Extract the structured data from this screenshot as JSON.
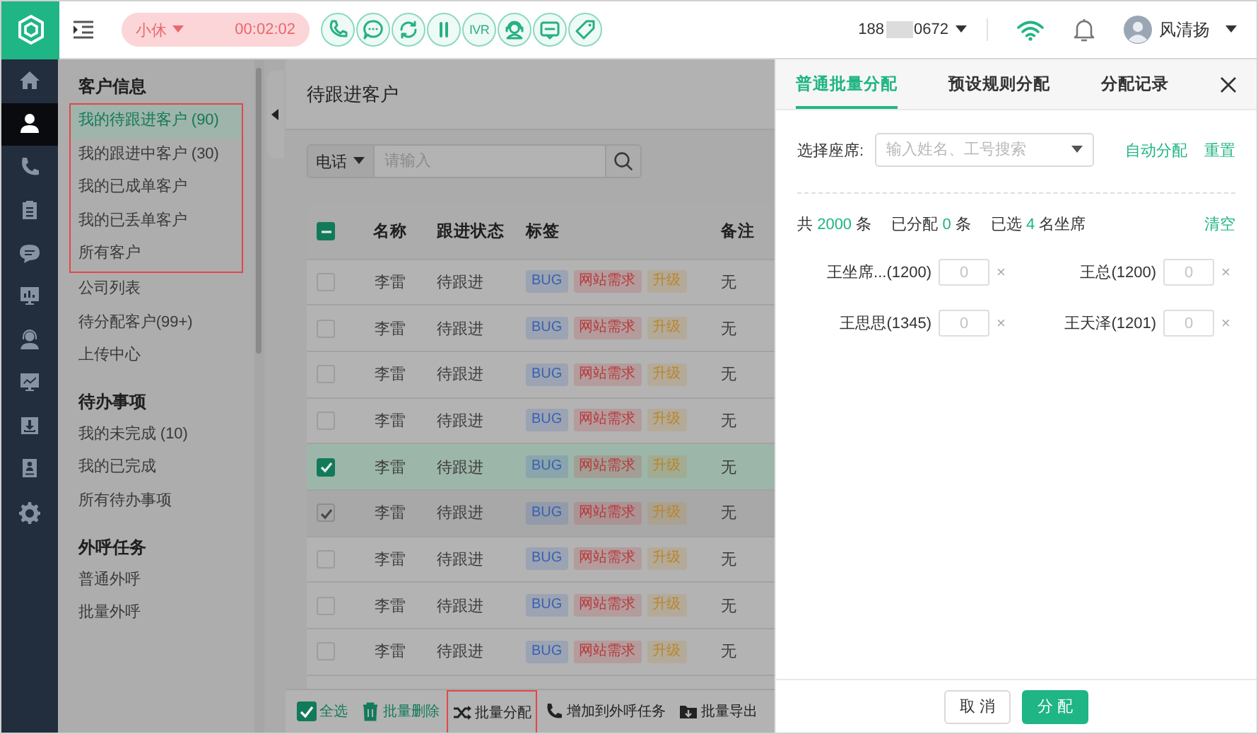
{
  "topbar": {
    "status": {
      "label": "小休",
      "timer": "00:02:02"
    },
    "ivr_label": "IVR",
    "phone": {
      "prefix": "188",
      "suffix": "0672"
    },
    "user": {
      "name": "风清扬"
    }
  },
  "rail": {
    "items": [
      {
        "selected": false
      },
      {
        "selected": true
      },
      {
        "selected": false
      },
      {
        "selected": false
      },
      {
        "selected": false
      },
      {
        "selected": false
      },
      {
        "selected": false
      },
      {
        "selected": false
      },
      {
        "selected": false
      },
      {
        "selected": false
      },
      {
        "selected": false
      }
    ]
  },
  "sidebar": {
    "sections": [
      {
        "title": "客户信息",
        "items": [
          {
            "label": "我的待跟进客户 (90)",
            "selected": true,
            "outlined": true
          },
          {
            "label": "我的跟进中客户 (30)",
            "selected": false,
            "outlined": true
          },
          {
            "label": "我的已成单客户",
            "selected": false,
            "outlined": true
          },
          {
            "label": "我的已丢单客户",
            "selected": false,
            "outlined": true
          },
          {
            "label": "所有客户",
            "selected": false,
            "outlined": true
          },
          {
            "label": "公司列表",
            "selected": false,
            "outlined": false
          },
          {
            "label": "待分配客户(99+)",
            "selected": false,
            "outlined": false
          },
          {
            "label": "上传中心",
            "selected": false,
            "outlined": false
          }
        ]
      },
      {
        "title": "待办事项",
        "items": [
          {
            "label": "我的未完成 (10)",
            "selected": false,
            "outlined": false
          },
          {
            "label": "我的已完成",
            "selected": false,
            "outlined": false
          },
          {
            "label": "所有待办事项",
            "selected": false,
            "outlined": false
          }
        ]
      },
      {
        "title": "外呼任务",
        "items": [
          {
            "label": "普通外呼",
            "selected": false,
            "outlined": false
          },
          {
            "label": "批量外呼",
            "selected": false,
            "outlined": false
          }
        ]
      }
    ]
  },
  "main": {
    "title": "待跟进客户",
    "search": {
      "type": "电话",
      "placeholder": "请输入"
    },
    "table": {
      "header_indeterminate": true,
      "columns": [
        "名称",
        "跟进状态",
        "标签",
        "备注"
      ],
      "rows": [
        {
          "checked": false,
          "disabled": false,
          "name": "李雷",
          "status": "待跟进",
          "tags": [
            {
              "label": "BUG",
              "color": "#3a62b0"
            },
            {
              "label": "网站需求",
              "color": "#b8383c"
            },
            {
              "label": "升级",
              "color": "#b8862c"
            }
          ],
          "note": "无"
        },
        {
          "checked": false,
          "disabled": false,
          "name": "李雷",
          "status": "待跟进",
          "tags": [
            {
              "label": "BUG",
              "color": "#3a62b0"
            },
            {
              "label": "网站需求",
              "color": "#b8383c"
            },
            {
              "label": "升级",
              "color": "#b8862c"
            }
          ],
          "note": "无"
        },
        {
          "checked": false,
          "disabled": false,
          "name": "李雷",
          "status": "待跟进",
          "tags": [
            {
              "label": "BUG",
              "color": "#3a62b0"
            },
            {
              "label": "网站需求",
              "color": "#b8383c"
            },
            {
              "label": "升级",
              "color": "#b8862c"
            }
          ],
          "note": "无"
        },
        {
          "checked": false,
          "disabled": false,
          "name": "李雷",
          "status": "待跟进",
          "tags": [
            {
              "label": "BUG",
              "color": "#3a62b0"
            },
            {
              "label": "网站需求",
              "color": "#b8383c"
            },
            {
              "label": "升级",
              "color": "#b8862c"
            }
          ],
          "note": "无"
        },
        {
          "checked": true,
          "disabled": false,
          "name": "李雷",
          "status": "待跟进",
          "tags": [
            {
              "label": "BUG",
              "color": "#3a62b0"
            },
            {
              "label": "网站需求",
              "color": "#b8383c"
            },
            {
              "label": "升级",
              "color": "#b8862c"
            }
          ],
          "note": "无"
        },
        {
          "checked": true,
          "disabled": true,
          "name": "李雷",
          "status": "待跟进",
          "tags": [
            {
              "label": "BUG",
              "color": "#3a62b0"
            },
            {
              "label": "网站需求",
              "color": "#b8383c"
            },
            {
              "label": "升级",
              "color": "#b8862c"
            }
          ],
          "note": "无"
        },
        {
          "checked": false,
          "disabled": false,
          "name": "李雷",
          "status": "待跟进",
          "tags": [
            {
              "label": "BUG",
              "color": "#3a62b0"
            },
            {
              "label": "网站需求",
              "color": "#b8383c"
            },
            {
              "label": "升级",
              "color": "#b8862c"
            }
          ],
          "note": "无"
        },
        {
          "checked": false,
          "disabled": false,
          "name": "李雷",
          "status": "待跟进",
          "tags": [
            {
              "label": "BUG",
              "color": "#3a62b0"
            },
            {
              "label": "网站需求",
              "color": "#b8383c"
            },
            {
              "label": "升级",
              "color": "#b8862c"
            }
          ],
          "note": "无"
        },
        {
          "checked": false,
          "disabled": false,
          "name": "李雷",
          "status": "待跟进",
          "tags": [
            {
              "label": "BUG",
              "color": "#3a62b0"
            },
            {
              "label": "网站需求",
              "color": "#b8383c"
            },
            {
              "label": "升级",
              "color": "#b8862c"
            }
          ],
          "note": "无"
        }
      ]
    },
    "select_all": {
      "label": "全选",
      "checked": true
    },
    "actions": [
      {
        "label": "批量删除",
        "kind": "delete",
        "outlined": false
      },
      {
        "label": "批量分配",
        "kind": "assign",
        "outlined": true
      },
      {
        "label": "增加到外呼任务",
        "kind": "call",
        "outlined": false
      },
      {
        "label": "批量导出",
        "kind": "export",
        "outlined": false
      }
    ]
  },
  "drawer": {
    "tabs": [
      {
        "label": "普通批量分配",
        "selected": true
      },
      {
        "label": "预设规则分配",
        "selected": false
      },
      {
        "label": "分配记录",
        "selected": false
      }
    ],
    "agent_select": {
      "label": "选择座席:",
      "placeholder": "输入姓名、工号搜索"
    },
    "links": [
      "自动分配",
      "重置"
    ],
    "stats": [
      {
        "prefix": "共",
        "value": "2000",
        "suffix": "条"
      },
      {
        "prefix": "已分配",
        "value": "0",
        "suffix": "条"
      },
      {
        "prefix": "已选",
        "value": "4",
        "suffix": "名坐席"
      }
    ],
    "clear_label": "清空",
    "agents": [
      {
        "name": "王坐席...(1200)",
        "placeholder": "0",
        "remove": "×"
      },
      {
        "name": "王总(1200)",
        "placeholder": "0",
        "remove": "×"
      },
      {
        "name": "王思思(1345)",
        "placeholder": "0",
        "remove": "×"
      },
      {
        "name": "王天泽(1201)",
        "placeholder": "0",
        "remove": "×"
      }
    ],
    "buttons": [
      {
        "label": "取 消",
        "kind": "default"
      },
      {
        "label": "分 配",
        "kind": "primary"
      }
    ]
  }
}
